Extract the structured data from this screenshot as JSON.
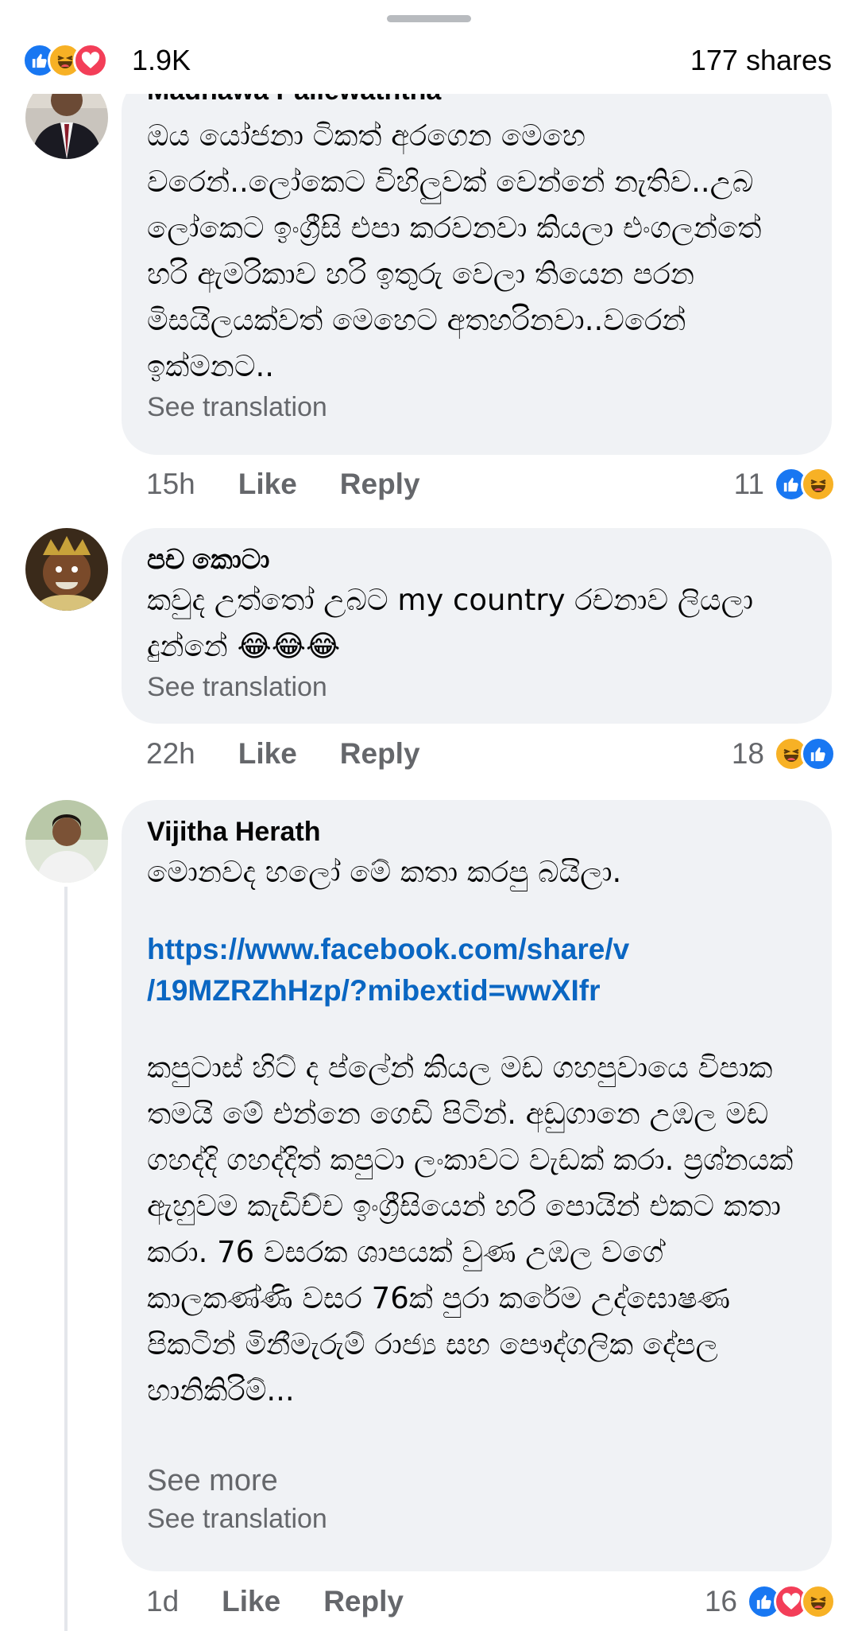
{
  "header": {
    "reaction_total": "1.9K",
    "shares": "177 shares",
    "reactions": [
      "like-icon",
      "haha-icon",
      "love-icon"
    ]
  },
  "comments": [
    {
      "author": "Madhawa Pallewaththa",
      "text": "ඔය යෝජනා ටිකත් අරගෙන මෙහෙ වරෙන්..ලෝකෙට විහිලුවක් වෙන්නේ නැතිව..උබ ලෝකෙට ඉංග්‍රීසි එපා කරවනවා කියලා එංගලන්තේ හරි ඇමරිකාව හරි ඉතුරු වෙලා තියෙන පරන මිසයිලයක්වත් මෙහෙට අතහරිනවා..වරෙන් ඉක්මනට..",
      "see_translation": "See translation",
      "time": "15h",
      "like": "Like",
      "reply": "Reply",
      "reaction_count": "11"
    },
    {
      "author": "පච කොටා",
      "text": "කවුද උත්තෝ උබට my country රචනාව ලියලා දුන්නේ 😂😂😂",
      "see_translation": "See translation",
      "time": "22h",
      "like": "Like",
      "reply": "Reply",
      "reaction_count": "18"
    },
    {
      "author": "Vijitha Herath",
      "text_intro": "මොනවද හලෝ මේ කතා කරපු බයිලා.",
      "link_line1": "https://www.facebook.com/share/v",
      "link_line2": "/19MZRZhHzp/?mibextid=wwXIfr",
      "text_body": "කපුටාස් හිට් ද ප්ලේන් කියල මඩ ගහපුවායෙ විපාක තමයි මේ එන්නෙ ගෙඩි පිටින්. අඩුගානෙ උඹල මඩ ගහද්දි ගහද්දිත් කපුටා ලංකාවට වැඩක් කරා. ප්‍රශ්නයක් ඇහුවම කැඩිච්ච ඉංග්‍රීසියෙන් හරි පොයින් එකට කතා කරා. 76 වසරක ශාපයක් වුණ උඹල වගේ කාලකණ්ණි වසර 76ක් පුරා කරේම උද්ඝොෂණ පිකටින් මිනීමැරුම් රාජ්‍ය සහ පෞද්ගලික දේපල හානිකිරිම්...",
      "see_more": "See more",
      "see_translation": "See translation",
      "time": "1d",
      "like": "Like",
      "reply": "Reply",
      "reaction_count": "16"
    }
  ],
  "colors": {
    "like": "#1877f2",
    "haha": "#f7b125",
    "love": "#f33e58",
    "link": "#0a66c2",
    "bubble": "#f0f2f5",
    "muted": "#65676b"
  }
}
